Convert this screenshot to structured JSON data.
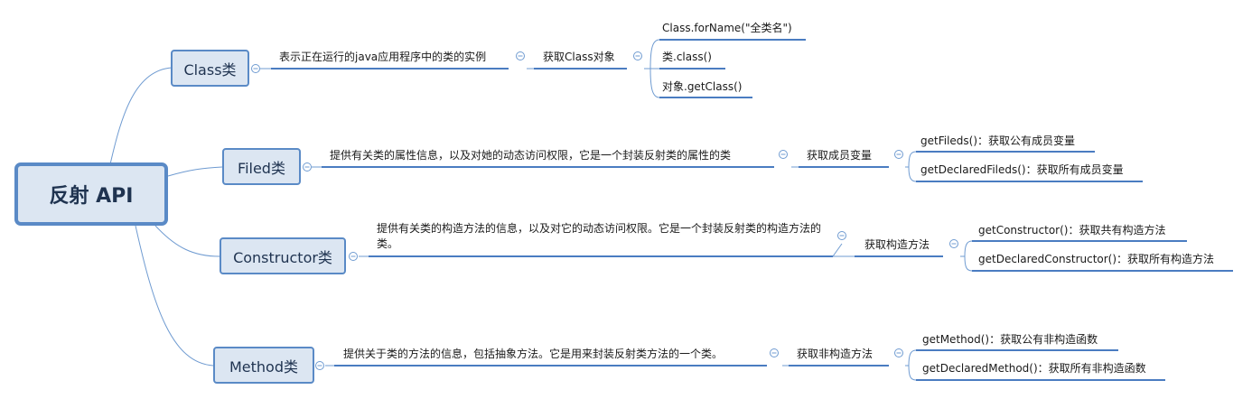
{
  "root": {
    "label": "反射 API"
  },
  "branches": [
    {
      "label": "Class类",
      "description": "表示正在运行的java应用程序中的类的实例",
      "action": "获取Class对象",
      "items": [
        "Class.forName(\"全类名\")",
        "类.class()",
        "对象.getClass()"
      ]
    },
    {
      "label": "Filed类",
      "description": "提供有关类的属性信息，以及对她的动态访问权限，它是一个封装反射类的属性的类",
      "action": "获取成员变量",
      "items": [
        "getFileds()：获取公有成员变量",
        "getDeclaredFileds()：获取所有成员变量"
      ]
    },
    {
      "label": "Constructor类",
      "description": "提供有关类的构造方法的信息，以及对它的动态访问权限。它是一个封装反射类的构造方法的类。",
      "action": "获取构造方法",
      "items": [
        "getConstructor()：获取共有构造方法",
        "getDeclaredConstructor()：获取所有构造方法"
      ]
    },
    {
      "label": "Method类",
      "description": "提供关于类的方法的信息，包括抽象方法。它是用来封装反射类方法的一个类。",
      "action": "获取非构造方法",
      "items": [
        "getMethod()：获取公有非构造函数",
        "getDeclaredMethod()：获取所有非构造函数"
      ]
    }
  ],
  "collapse_symbol": "⊖",
  "colors": {
    "line": "#4a7cc1",
    "connector": "#6f9bd1",
    "box_fill": "#dce6f2",
    "box_border": "#5a8ac6"
  }
}
